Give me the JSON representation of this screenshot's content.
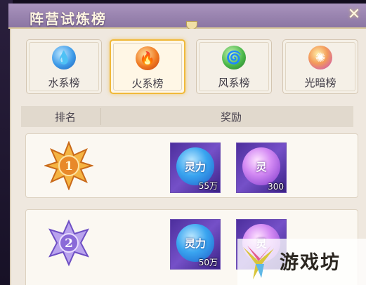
{
  "header": {
    "title": "阵营试炼榜",
    "close_symbol": "✕"
  },
  "tabs": [
    {
      "label": "水系榜",
      "icon": "water-icon",
      "color": "#3e9be8",
      "active": false
    },
    {
      "label": "火系榜",
      "icon": "fire-icon",
      "color": "#f07a22",
      "active": true
    },
    {
      "label": "风系榜",
      "icon": "wind-icon",
      "color": "#4bb84a",
      "active": false
    },
    {
      "label": "光暗榜",
      "icon": "light-dark-icon",
      "color": "#e67ac8",
      "active": false
    }
  ],
  "table": {
    "headers": {
      "rank": "排名",
      "reward": "奖励"
    },
    "rows": [
      {
        "rank": "1",
        "badge_color": "#e8892a",
        "rewards": [
          {
            "name": "灵力",
            "qty": "55万",
            "icon": "spirit-power-orb-icon"
          },
          {
            "name": "灵",
            "qty": "300",
            "icon": "spirit-orb-icon"
          }
        ]
      },
      {
        "rank": "2",
        "badge_color": "#8a6ad8",
        "rewards": [
          {
            "name": "灵力",
            "qty": "50万",
            "icon": "spirit-power-orb-icon"
          },
          {
            "name": "灵",
            "qty": "",
            "icon": "spirit-orb-icon"
          }
        ]
      }
    ]
  },
  "watermark": {
    "text": "游戏坊"
  }
}
